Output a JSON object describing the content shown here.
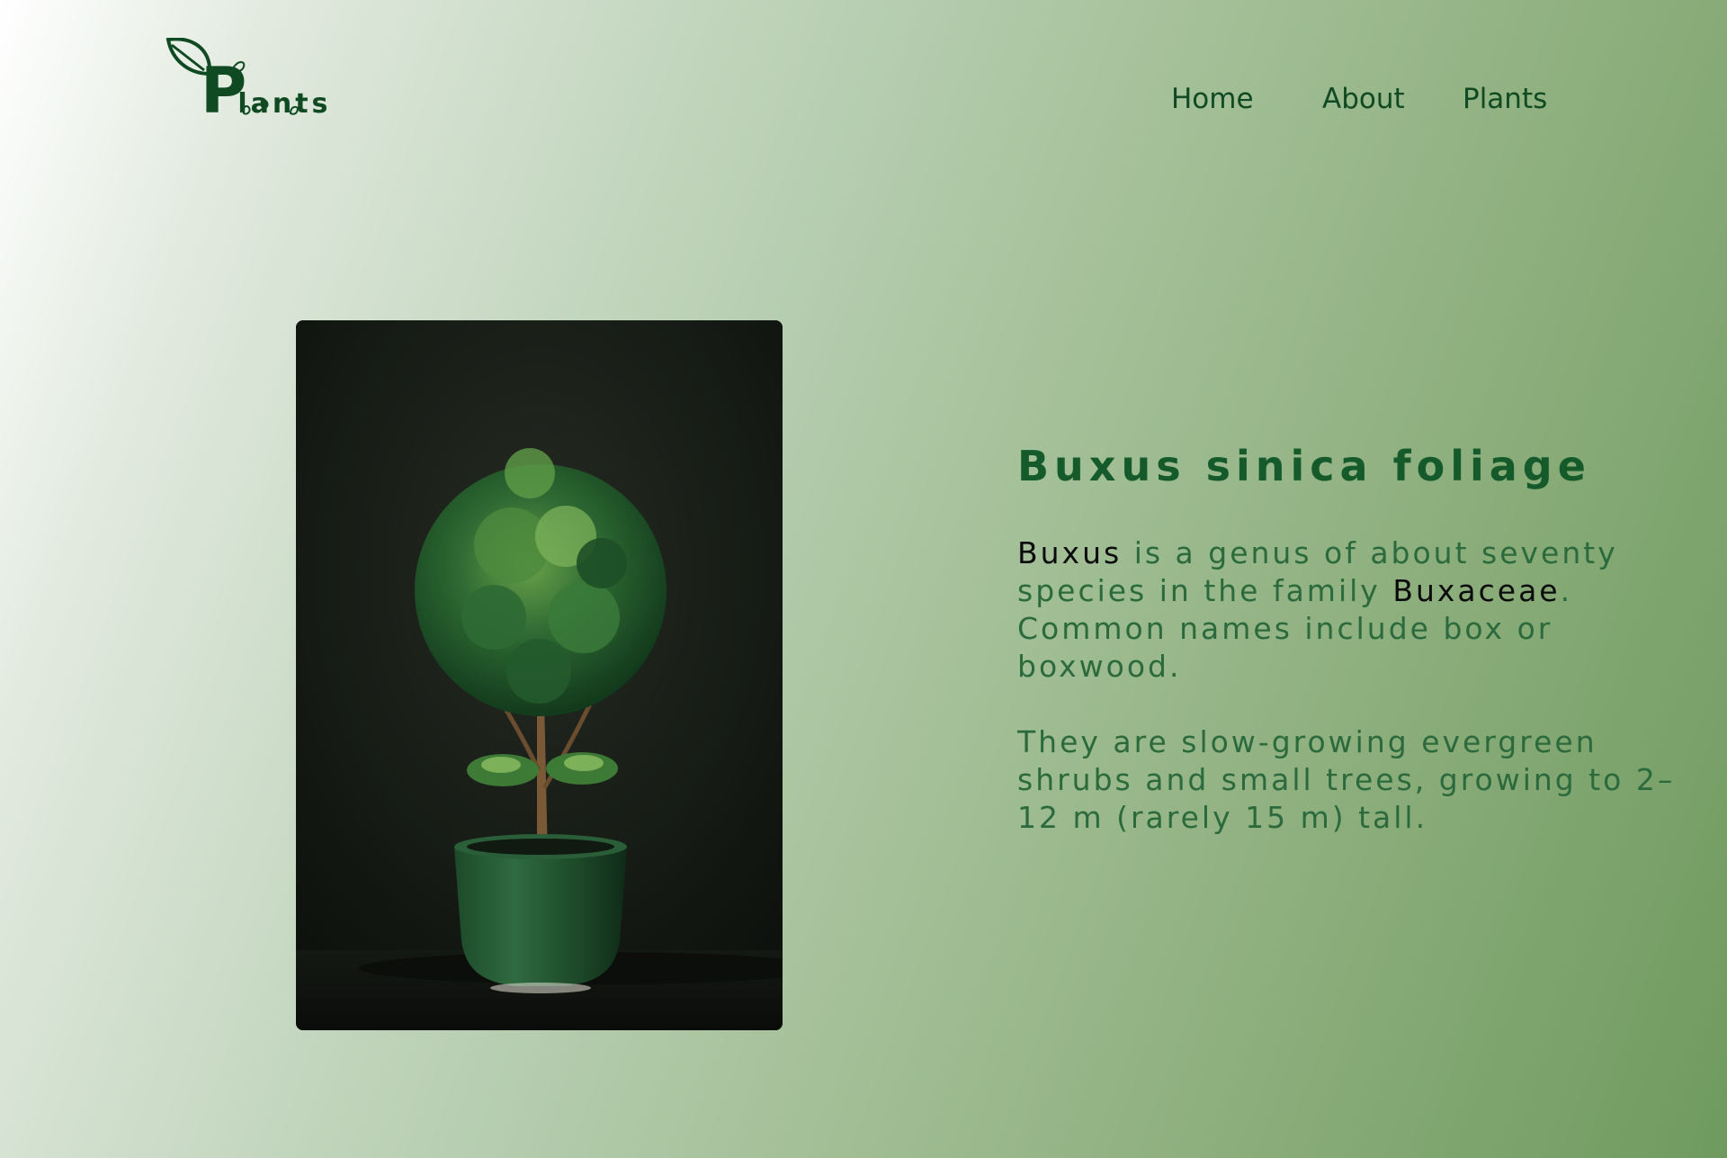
{
  "logo": {
    "letter": "P",
    "rest": "lants"
  },
  "nav": {
    "items": [
      {
        "label": "Home"
      },
      {
        "label": "About"
      },
      {
        "label": "Plants"
      }
    ]
  },
  "hero": {
    "image_alt": "Potted boxwood plant",
    "title": "Buxus sinica foliage",
    "p1_term1": "Buxus",
    "p1_text1": " is a genus of about seventy species in the family ",
    "p1_term2": "Buxaceae",
    "p1_text2": ". Common names include box or boxwood.",
    "p2": "They are slow-growing evergreen shrubs and small trees, growing to 2–12 m (rarely 15 m) tall."
  },
  "colors": {
    "brand_green": "#145a2a",
    "text_green": "#2b6a3c"
  }
}
